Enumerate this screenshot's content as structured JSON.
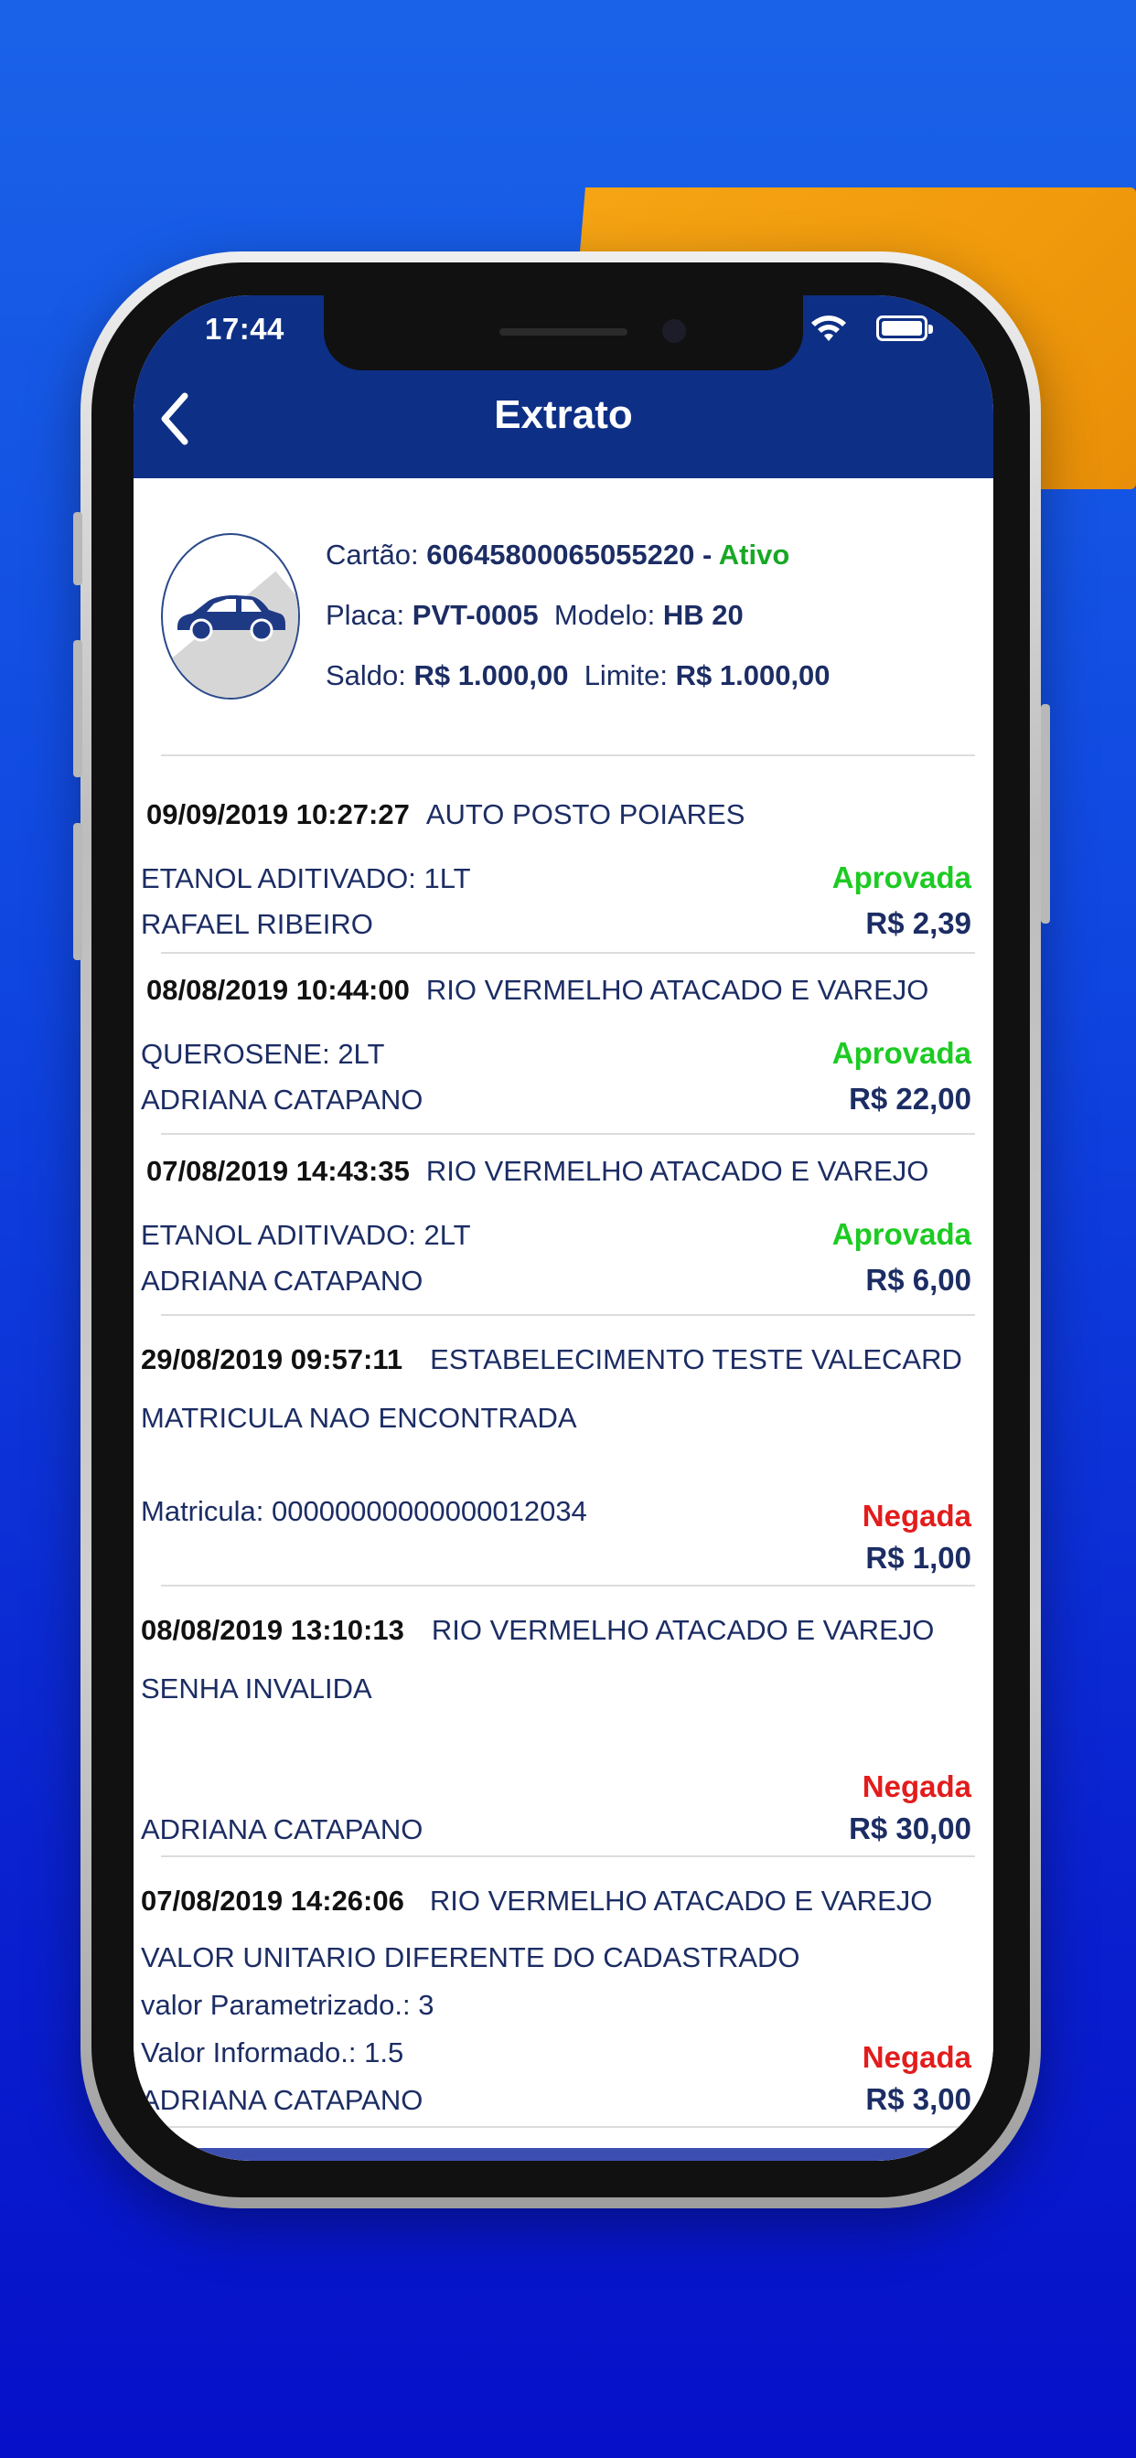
{
  "status_bar": {
    "time": "17:44"
  },
  "nav": {
    "back_label": "<",
    "title": "Extrato"
  },
  "card": {
    "card_label": "Cartão:",
    "card_number": "60645800065055220",
    "card_sep": " - ",
    "card_status": "Ativo",
    "plate_label": "Placa:",
    "plate": "PVT-0005",
    "model_label": "Modelo:",
    "model": "HB 20",
    "balance_label": "Saldo:",
    "balance": "R$ 1.000,00",
    "limit_label": "Limite:",
    "limit": "R$ 1.000,00"
  },
  "transactions": [
    {
      "date": "09/09/2019 10:27:27",
      "place": "AUTO POSTO POIARES",
      "line1": "ETANOL ADITIVADO: 1LT",
      "line2": "RAFAEL RIBEIRO",
      "status": "Aprovada",
      "amount": "R$ 2,39"
    },
    {
      "date": "08/08/2019 10:44:00",
      "place": "RIO VERMELHO ATACADO E VAREJO",
      "line1": "QUEROSENE: 2LT",
      "line2": "ADRIANA CATAPANO",
      "status": "Aprovada",
      "amount": "R$ 22,00"
    },
    {
      "date": "07/08/2019 14:43:35",
      "place": "RIO VERMELHO ATACADO E VAREJO",
      "line1": "ETANOL ADITIVADO: 2LT",
      "line2": "ADRIANA CATAPANO",
      "status": "Aprovada",
      "amount": "R$ 6,00"
    },
    {
      "date": "29/08/2019 09:57:11",
      "place": "ESTABELECIMENTO TESTE VALECARD",
      "line1": "MATRICULA NAO ENCONTRADA",
      "line2": "Matricula: 00000000000000012034",
      "status": "Negada",
      "amount": "R$ 1,00"
    },
    {
      "date": "08/08/2019 13:10:13",
      "place": "RIO VERMELHO ATACADO E VAREJO",
      "line1": "SENHA INVALIDA",
      "line2": "ADRIANA CATAPANO",
      "status": "Negada",
      "amount": "R$ 30,00"
    },
    {
      "date": "07/08/2019 14:26:06",
      "place": "RIO VERMELHO ATACADO E VAREJO",
      "line1": "VALOR UNITARIO DIFERENTE DO CADASTRADO",
      "line2": "valor Parametrizado.: 3",
      "line3": "Valor Informado.: 1.5",
      "line4": "ADRIANA CATAPANO",
      "status": "Negada",
      "amount": "R$ 3,00"
    }
  ],
  "colors": {
    "nav_bar": "#0d2f86",
    "approved": "#1ccb22",
    "denied": "#e31c1c",
    "text": "#1c2d64"
  }
}
